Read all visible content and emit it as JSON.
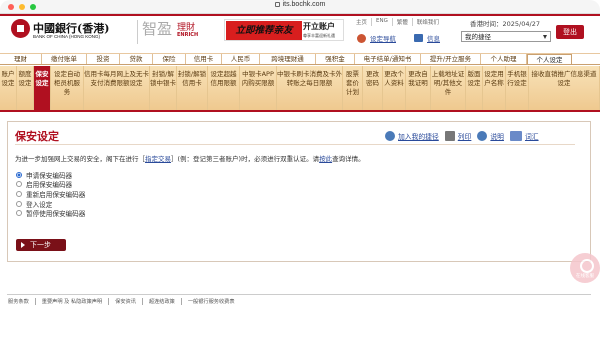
{
  "window": {
    "url": "its.bochk.com"
  },
  "header": {
    "bank_name_cn": "中國銀行(香港)",
    "bank_name_en": "BANK OF CHINA (HONG KONG)",
    "enrich_cn_a": "智盈",
    "enrich_cn_b": "理財",
    "enrich_en": "ENRICH",
    "banner_left": "立即推荐亲友",
    "banner_right": "开立账户",
    "banner_sub": "尊享丰富迎新礼遇",
    "top_links": [
      "主页",
      "ENG",
      "繁體",
      "联络我们"
    ],
    "hk_time": "香港时间：2025/04/27",
    "nav_setting": "设定导航",
    "inbox": "信息",
    "quick_select": "我的捷径",
    "logout": "登出"
  },
  "nav": [
    {
      "label": "理财",
      "active": false
    },
    {
      "label": "缴付账单",
      "active": false
    },
    {
      "label": "投资",
      "active": false
    },
    {
      "label": "贷款",
      "active": false
    },
    {
      "label": "保险",
      "active": false
    },
    {
      "label": "信用卡",
      "active": false
    },
    {
      "label": "人民币",
      "active": false
    },
    {
      "label": "跨境理财通",
      "active": false
    },
    {
      "label": "强积金",
      "active": false
    },
    {
      "label": "电子结单/通知书",
      "active": false
    },
    {
      "label": "提升/开立服务",
      "active": false
    },
    {
      "label": "个人助理",
      "active": false
    },
    {
      "label": "个人设定",
      "active": true
    }
  ],
  "subnav": [
    {
      "label": "账户设定",
      "active": false
    },
    {
      "label": "额度设定",
      "active": false
    },
    {
      "label": "保安设定",
      "active": true
    },
    {
      "label": "设定自动柜员机服务",
      "active": false
    },
    {
      "label": "信用卡每月网上及无卡支付消费限额设定",
      "active": false
    },
    {
      "label": "封锁/解锁中银卡",
      "active": false
    },
    {
      "label": "封锁/解锁信用卡",
      "active": false
    },
    {
      "label": "设定超越信用限额",
      "active": false
    },
    {
      "label": "中银卡APP内购买限额",
      "active": false
    },
    {
      "label": "中银卡刷卡消费及卡外转账之每日限额",
      "active": false
    },
    {
      "label": "股票套价计划",
      "active": false
    },
    {
      "label": "更改密码",
      "active": false
    },
    {
      "label": "更改个人资料",
      "active": false
    },
    {
      "label": "更改自我证明",
      "active": false
    },
    {
      "label": "上载地址证明/其他文件",
      "active": false
    },
    {
      "label": "版面设定",
      "active": false
    },
    {
      "label": "设定用户名称",
      "active": false
    },
    {
      "label": "手机银行设定",
      "active": false
    },
    {
      "label": "接收直销推广信息渠道设定",
      "active": false
    }
  ],
  "main": {
    "title": "保安设定",
    "tools": [
      {
        "label": "加入我的捷径",
        "icon": "bookmark-icon"
      },
      {
        "label": "列印",
        "icon": "printer-icon"
      },
      {
        "label": "说明",
        "icon": "help-icon"
      },
      {
        "label": "词汇",
        "icon": "glossary-icon"
      }
    ],
    "intro_a": "为进一步加强网上交易的安全，阁下在进行［",
    "intro_link": "指定交易",
    "intro_b": "］(例：登记第三者账户)时，必须进行双重认证。请",
    "intro_link2": "按此",
    "intro_c": "查询详情。",
    "options": [
      {
        "label": "申请保安编码器",
        "selected": true
      },
      {
        "label": "启用保安编码器",
        "selected": false
      },
      {
        "label": "重新启用保安编码器",
        "selected": false
      },
      {
        "label": "登入设定",
        "selected": false
      },
      {
        "label": "暂停使用保安编码器",
        "selected": false
      }
    ],
    "next_label": "下一步"
  },
  "float_label": "在线客服",
  "footer": [
    "服务条款",
    "重要声明 及 私隐政策声明",
    "保安资讯",
    "超连结政策",
    "一般银行服务收费表"
  ],
  "colors": {
    "brand": "#b01020",
    "nav_bg": "#f3d8a6"
  }
}
